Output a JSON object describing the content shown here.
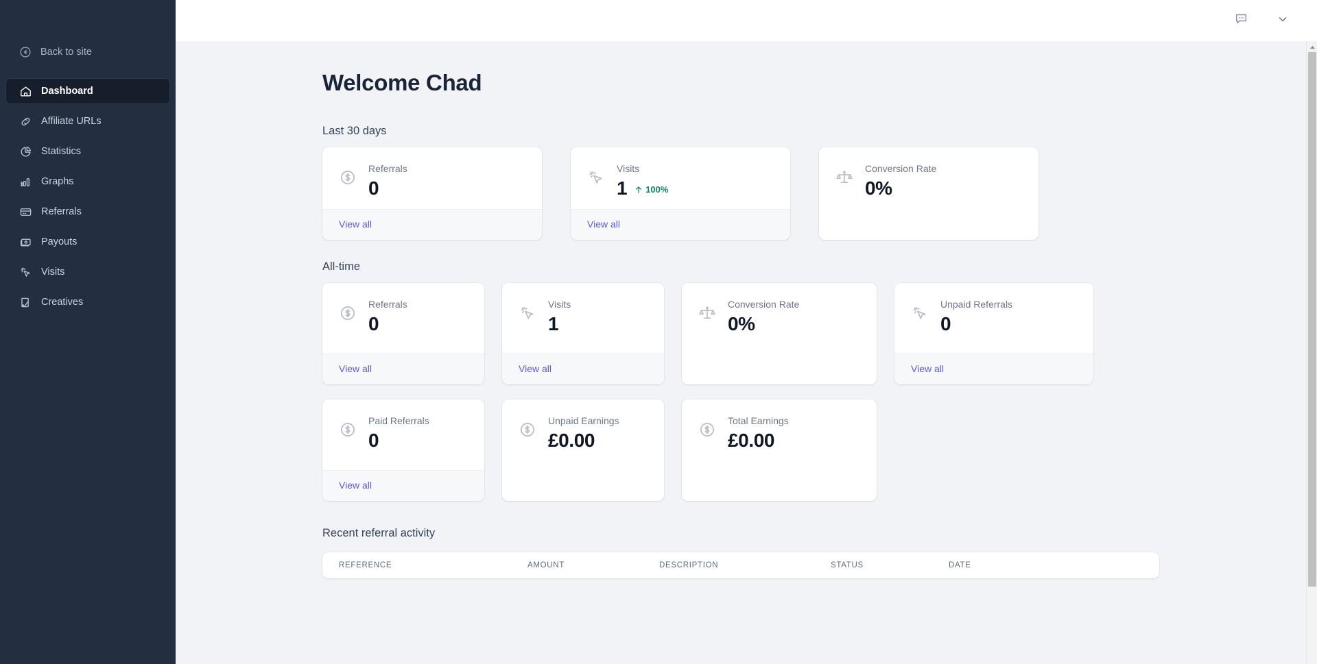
{
  "sidebar": {
    "back": {
      "label": "Back to site",
      "icon": "arrow-circle-left-icon"
    },
    "items": [
      {
        "label": "Dashboard",
        "icon": "home-icon",
        "active": true
      },
      {
        "label": "Affiliate URLs",
        "icon": "link-icon",
        "active": false
      },
      {
        "label": "Statistics",
        "icon": "pie-chart-icon",
        "active": false
      },
      {
        "label": "Graphs",
        "icon": "bar-chart-icon",
        "active": false
      },
      {
        "label": "Referrals",
        "icon": "credit-card-icon",
        "active": false
      },
      {
        "label": "Payouts",
        "icon": "money-stack-icon",
        "active": false
      },
      {
        "label": "Visits",
        "icon": "cursor-click-icon",
        "active": false
      },
      {
        "label": "Creatives",
        "icon": "image-icon",
        "active": false
      }
    ]
  },
  "topbar": {
    "chat_icon": "chat-bubble-icon",
    "chevron_icon": "chevron-down-icon"
  },
  "page": {
    "title": "Welcome Chad",
    "sections": {
      "last30": "Last 30 days",
      "alltime": "All-time",
      "recent": "Recent referral activity"
    },
    "view_all": "View all"
  },
  "last30_cards": [
    {
      "label": "Referrals",
      "value": "0",
      "icon": "dollar-coin-icon",
      "has_footer": true,
      "delta": null
    },
    {
      "label": "Visits",
      "value": "1",
      "icon": "cursor-click-icon",
      "has_footer": true,
      "delta": "100%",
      "delta_dir": "up"
    },
    {
      "label": "Conversion Rate",
      "value": "0%",
      "icon": "scales-icon",
      "has_footer": false,
      "delta": null
    }
  ],
  "alltime_cards": [
    {
      "label": "Referrals",
      "value": "0",
      "icon": "dollar-coin-icon",
      "has_footer": true
    },
    {
      "label": "Visits",
      "value": "1",
      "icon": "cursor-click-icon",
      "has_footer": true
    },
    {
      "label": "Conversion Rate",
      "value": "0%",
      "icon": "scales-icon",
      "has_footer": false
    },
    {
      "label": "Unpaid Referrals",
      "value": "0",
      "icon": "cursor-click-icon",
      "has_footer": true
    }
  ],
  "earnings_cards": [
    {
      "label": "Paid Referrals",
      "value": "0",
      "icon": "dollar-coin-icon",
      "has_footer": true
    },
    {
      "label": "Unpaid Earnings",
      "value": "£0.00",
      "icon": "dollar-coin-icon",
      "has_footer": false
    },
    {
      "label": "Total Earnings",
      "value": "£0.00",
      "icon": "dollar-coin-icon",
      "has_footer": false
    }
  ],
  "table": {
    "columns": [
      "REFERENCE",
      "AMOUNT",
      "DESCRIPTION",
      "STATUS",
      "DATE"
    ],
    "rows": []
  },
  "colors": {
    "sidebar_bg": "#232f41",
    "sidebar_active_bg": "#161e2c",
    "page_bg": "#f1f3f6",
    "link": "#5b5bd6",
    "positive": "#0d8a5f",
    "value": "#101828"
  }
}
